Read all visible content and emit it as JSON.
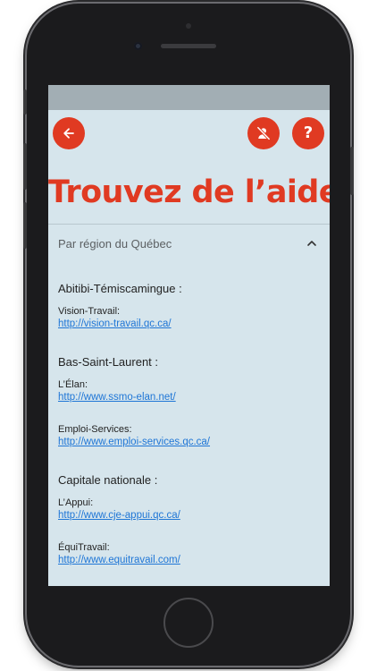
{
  "header": {
    "title": "Trouvez de l’aide",
    "help_label": "?"
  },
  "accordion": {
    "label": "Par région du Québec"
  },
  "regions": [
    {
      "name": "Abitibi-Témiscamingue :",
      "entries": [
        {
          "name": "Vision-Travail:",
          "url": "http://vision-travail.qc.ca/"
        }
      ]
    },
    {
      "name": "Bas-Saint-Laurent :",
      "entries": [
        {
          "name": "L’Élan:",
          "url": "http://www.ssmo-elan.net/"
        },
        {
          "name": "Emploi-Services:",
          "url": "http://www.emploi-services.qc.ca/"
        }
      ]
    },
    {
      "name": "Capitale nationale :",
      "entries": [
        {
          "name": "L’Appui:",
          "url": "http://www.cje-appui.qc.ca/"
        },
        {
          "name": "ÉquiTravail:",
          "url": "http://www.equitravail.com/"
        }
      ]
    }
  ],
  "colors": {
    "accent": "#e03a22",
    "screen_bg": "#d6e5ec",
    "link": "#1f76d6"
  },
  "icons": {
    "back": "arrow-left-icon",
    "user_off": "user-off-icon",
    "help": "help-icon",
    "chevron": "chevron-up-icon"
  }
}
